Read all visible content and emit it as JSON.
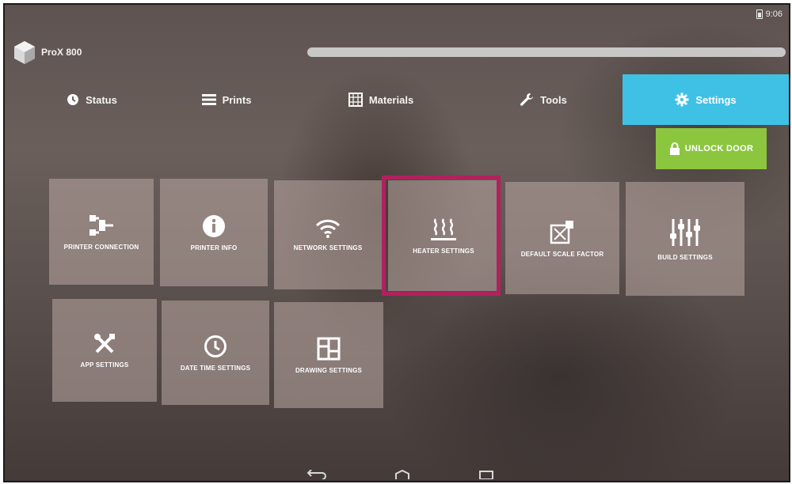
{
  "status_bar": {
    "time": "9:06",
    "icons": [
      "battery-icon"
    ]
  },
  "app": {
    "title": "ProX 800",
    "logo": "cube-logo-icon"
  },
  "tabs": [
    {
      "label": "Status",
      "icon": "clock-icon",
      "active": false
    },
    {
      "label": "Prints",
      "icon": "list-icon",
      "active": false
    },
    {
      "label": "Materials",
      "icon": "materials-icon",
      "active": false
    },
    {
      "label": "Tools",
      "icon": "wrench-icon",
      "active": false
    },
    {
      "label": "Settings",
      "icon": "gear-icon",
      "active": true
    }
  ],
  "unlock_door": {
    "label": "UNLOCK DOOR",
    "icon": "lock-icon"
  },
  "tiles": [
    {
      "label": "PRINTER CONNECTION",
      "icon": "connection-icon"
    },
    {
      "label": "PRINTER INFO",
      "icon": "info-icon"
    },
    {
      "label": "NETWORK SETTINGS",
      "icon": "wifi-icon"
    },
    {
      "label": "HEATER SETTINGS",
      "icon": "heat-icon",
      "highlighted": true
    },
    {
      "label": "DEFAULT SCALE FACTOR",
      "icon": "scale-icon"
    },
    {
      "label": "BUILD SETTINGS",
      "icon": "sliders-icon"
    },
    {
      "label": "APP SETTINGS",
      "icon": "tools-icon"
    },
    {
      "label": "DATE TIME SETTINGS",
      "icon": "clock-icon"
    },
    {
      "label": "DRAWING SETTINGS",
      "icon": "layout-icon"
    }
  ],
  "colors": {
    "accent": "#3fc1e6",
    "unlock": "#8cc63f",
    "highlight": "#b0215e"
  },
  "nav_bar": [
    "back-icon",
    "home-icon",
    "recents-icon"
  ]
}
